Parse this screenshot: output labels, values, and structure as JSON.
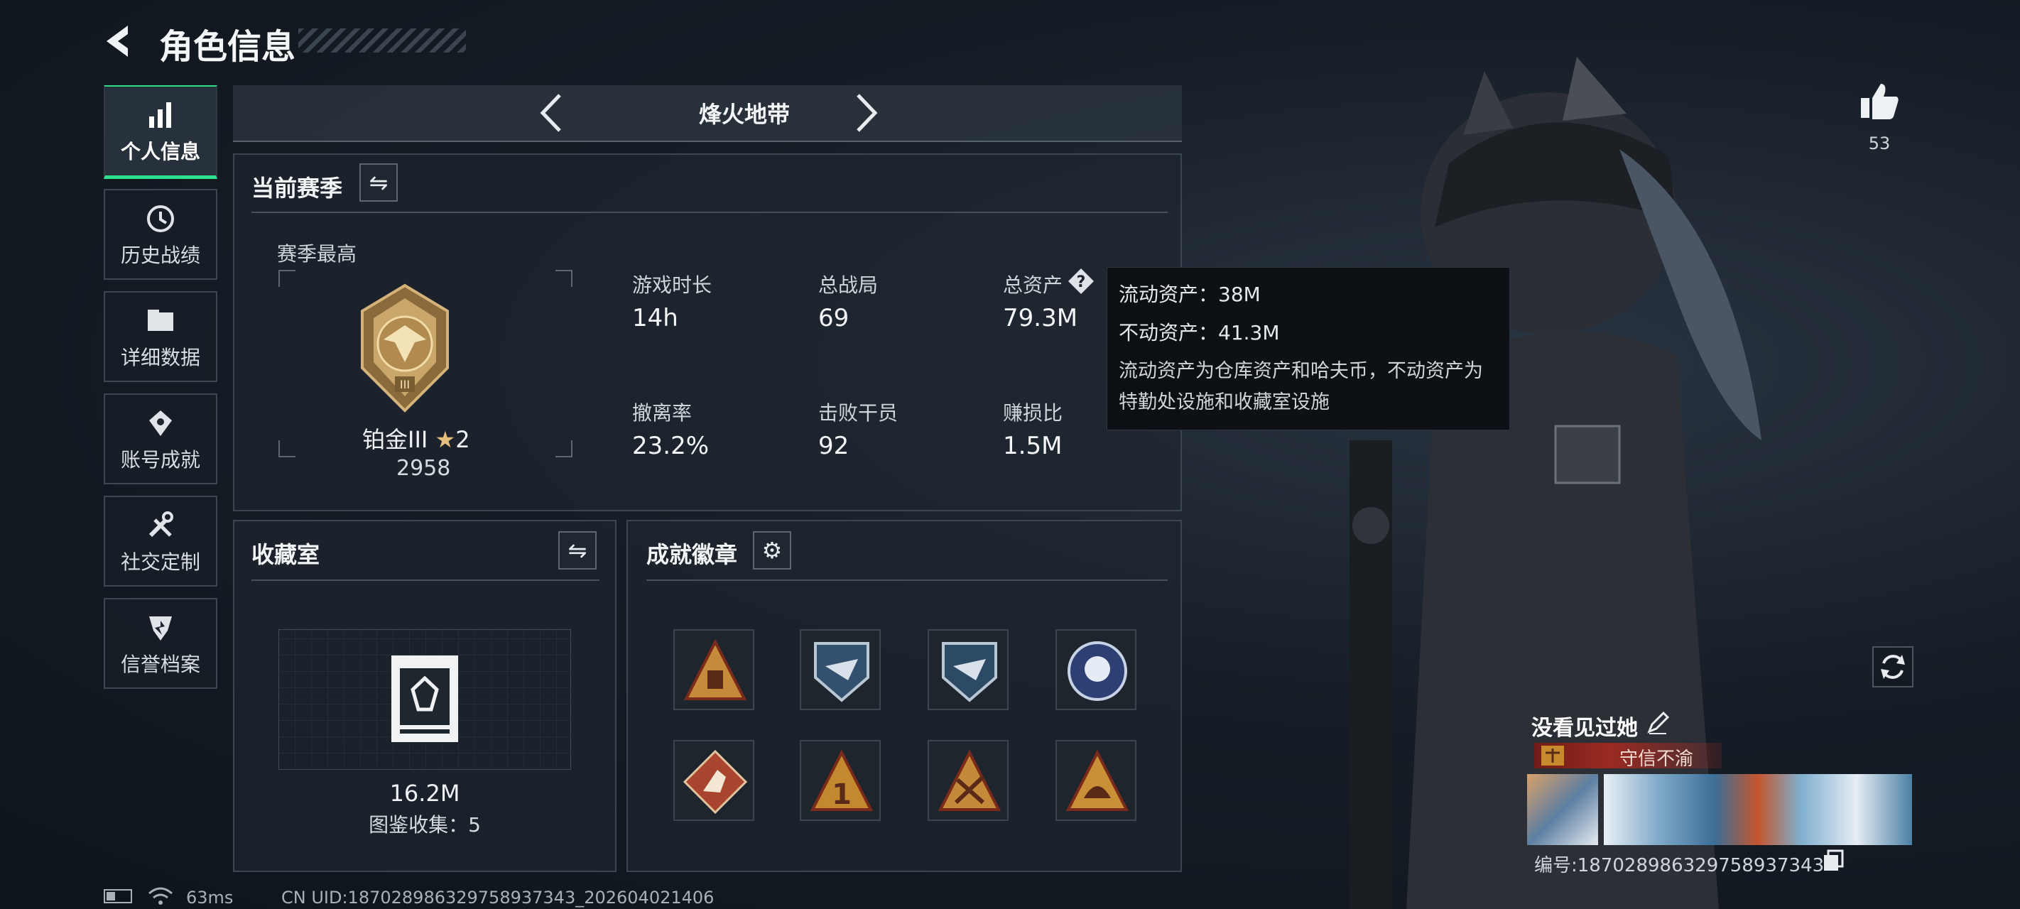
{
  "header": {
    "title": "角色信息"
  },
  "sidebar": {
    "items": [
      {
        "label": "个人信息",
        "icon": "bar-chart-icon"
      },
      {
        "label": "历史战绩",
        "icon": "history-icon"
      },
      {
        "label": "详细数据",
        "icon": "folder-icon"
      },
      {
        "label": "账号成就",
        "icon": "achievement-icon"
      },
      {
        "label": "社交定制",
        "icon": "tools-icon"
      },
      {
        "label": "信誉档案",
        "icon": "shield-icon"
      }
    ]
  },
  "mode_selector": {
    "label": "烽火地带"
  },
  "season": {
    "title": "当前赛季",
    "best_label": "赛季最高",
    "rank_name": "铂金III",
    "rank_stars": "2",
    "rank_score": "2958",
    "stats": [
      {
        "label": "游戏时长",
        "value": "14h"
      },
      {
        "label": "总战局",
        "value": "69"
      },
      {
        "label": "总资产",
        "value": "79.3M"
      },
      {
        "label": "撤离率",
        "value": "23.2%"
      },
      {
        "label": "击败干员",
        "value": "92"
      },
      {
        "label": "赚损比",
        "value": "1.5M"
      }
    ]
  },
  "tooltip": {
    "liquid": "流动资产：38M",
    "fixed": "不动资产：41.3M",
    "description": "流动资产为仓库资产和哈夫币，不动资产为特勤处设施和收藏室设施"
  },
  "collection": {
    "title": "收藏室",
    "value": "16.2M",
    "catalog": "图鉴收集：5"
  },
  "achievements": {
    "title": "成就徽章",
    "badges": [
      "triangle-gold-badge",
      "eagle-shield-badge",
      "eagle-shield-badge-2",
      "round-emblem-badge",
      "diamond-runner-badge",
      "triangle-one-badge",
      "triangle-crossed-badge",
      "triangle-helmet-badge"
    ]
  },
  "likes": {
    "count": "53"
  },
  "profile": {
    "name": "没看见过她",
    "title": "守信不渝",
    "id_text": "编号:18702898632975893734​3"
  },
  "status_bar": {
    "ping": "63ms",
    "uid": "CN UID:18702898632975893734​3_202604021406"
  },
  "colors": {
    "accent": "#2ee08c",
    "tooltip_bg": "#0c0f13",
    "title_red": "#9a2a22"
  }
}
